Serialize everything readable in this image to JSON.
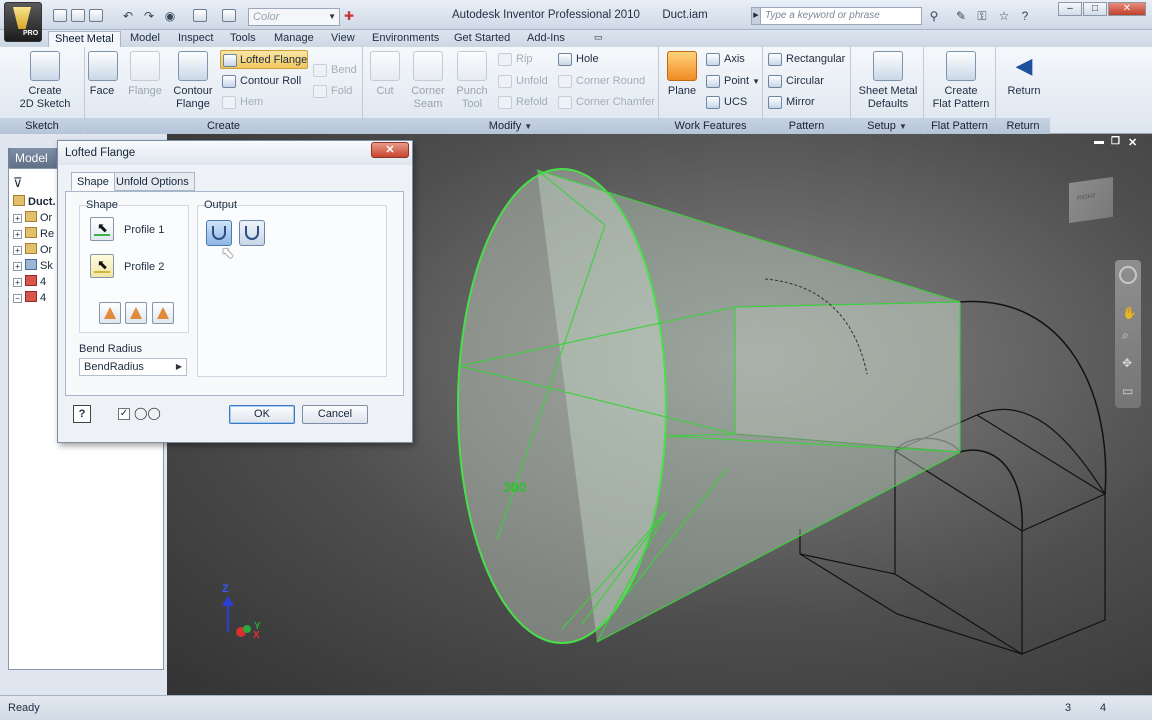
{
  "window": {
    "app_title": "Autodesk Inventor Professional 2010",
    "document": "Duct.iam",
    "search_placeholder": "Type a keyword or phrase",
    "color_combo": "Color",
    "app_badge": "PRO",
    "min": "–",
    "max": "□",
    "close": "✕"
  },
  "tabs": [
    "Sheet Metal",
    "Model",
    "Inspect",
    "Tools",
    "Manage",
    "View",
    "Environments",
    "Get Started",
    "Add-Ins"
  ],
  "ribbon": {
    "sketch": {
      "label": "Sketch",
      "create_sketch": "Create\n2D Sketch"
    },
    "create": {
      "label": "Create",
      "face": "Face",
      "flange": "Flange",
      "contour_flange": "Contour\nFlange",
      "lofted_flange": "Lofted Flange",
      "contour_roll": "Contour Roll",
      "hem": "Hem",
      "bend": "Bend",
      "fold": "Fold"
    },
    "modify": {
      "label": "Modify",
      "cut": "Cut",
      "corner_seam": "Corner\nSeam",
      "punch_tool": "Punch\nTool",
      "rip": "Rip",
      "unfold": "Unfold",
      "refold": "Refold",
      "hole": "Hole",
      "corner_round": "Corner Round",
      "corner_chamfer": "Corner Chamfer"
    },
    "work_features": {
      "label": "Work Features",
      "plane": "Plane",
      "axis": "Axis",
      "point": "Point",
      "ucs": "UCS"
    },
    "pattern": {
      "label": "Pattern",
      "rectangular": "Rectangular",
      "circular": "Circular",
      "mirror": "Mirror"
    },
    "setup": {
      "label": "Setup",
      "defaults": "Sheet Metal\nDefaults"
    },
    "flat_pattern": {
      "label": "Flat Pattern",
      "create": "Create\nFlat Pattern"
    },
    "return": {
      "label": "Return",
      "return": "Return"
    }
  },
  "browser": {
    "tab": "Model",
    "items": [
      "Duct.",
      "Or",
      "Re",
      "Or",
      "Sk",
      "4",
      "4"
    ]
  },
  "dialog": {
    "title": "Lofted Flange",
    "tabs": [
      "Shape",
      "Unfold Options"
    ],
    "shape_group": "Shape",
    "profile1": "Profile 1",
    "profile2": "Profile 2",
    "output_group": "Output",
    "bend_radius_label": "Bend Radius",
    "bend_radius_value": "BendRadius",
    "ok": "OK",
    "cancel": "Cancel",
    "help": "?",
    "preview_checked": "✓"
  },
  "viewport": {
    "dimension": "300",
    "viewcube_face": "RIGHT",
    "axes": [
      "Z",
      "Y",
      "X"
    ]
  },
  "status": {
    "text": "Ready",
    "n1": "3",
    "n2": "4"
  }
}
